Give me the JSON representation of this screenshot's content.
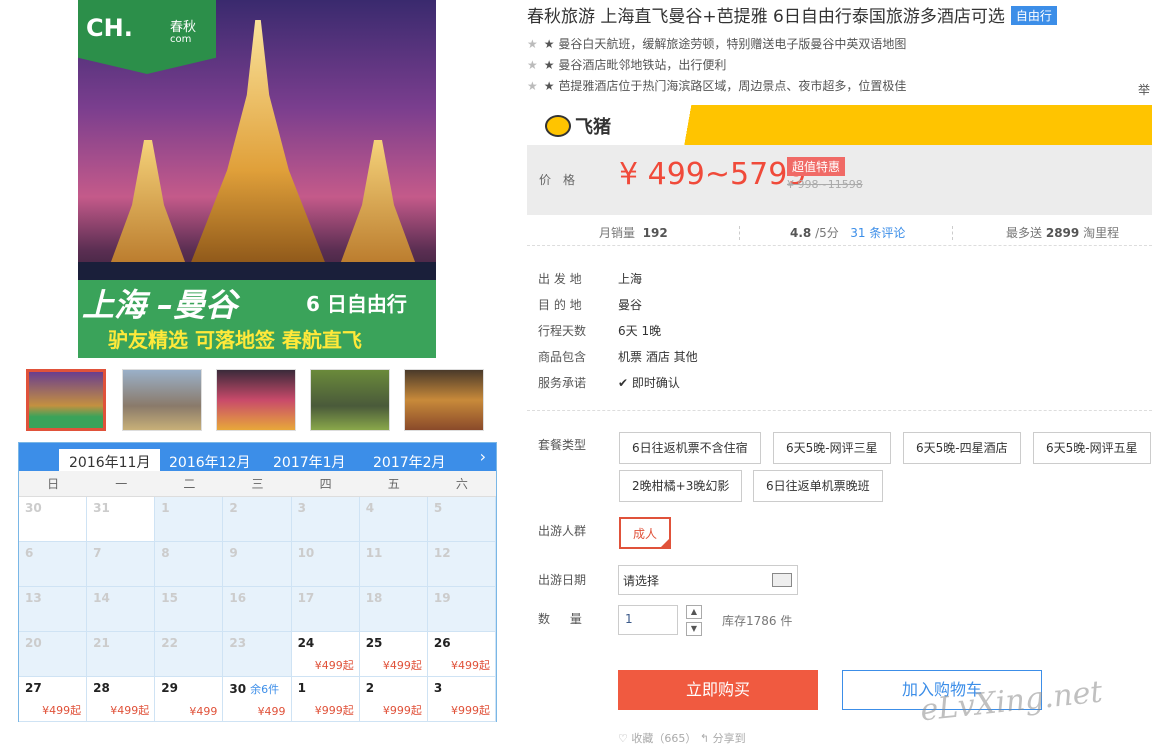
{
  "product": {
    "title": "春秋旅游 上海直飞曼谷+芭提雅 6日自由行泰国旅游多酒店可选",
    "badge": "自由行",
    "features": [
      "★ 曼谷白天航班，缓解旅途劳顿，特别赠送电子版曼谷中英双语地图",
      "★ 曼谷酒店毗邻地铁站，出行便利",
      "★ 芭提雅酒店位于热门海滨路区域，周边景点、夜市超多，位置极佳"
    ],
    "side_cut": "举"
  },
  "main_image": {
    "logo_ch": "CH.",
    "logo_cq": "春秋",
    "logo_com": "com",
    "banner_line1": "上海 –曼谷",
    "banner_line2": "6 日自由行",
    "banner_line3": "驴友精选 可落地签 春航直飞"
  },
  "platform": {
    "name": "飞猪",
    "accent": "#ffc400"
  },
  "price": {
    "label": "价格",
    "value": "¥ 499~5799",
    "hot": "超值特惠",
    "old": "¥ 998~11598",
    "color": "#f04a3a"
  },
  "stats": {
    "sales_label": "月销量",
    "sales": "192",
    "rating": "4.8",
    "rating_suffix": "/5分",
    "reviews": "31 条评论",
    "points_prefix": "最多送",
    "points": "2899",
    "points_suffix": "淘里程"
  },
  "info": {
    "depart_label": "出 发 地",
    "depart": "上海",
    "dest_label": "目 的 地",
    "dest": "曼谷",
    "days_label": "行程天数",
    "days": "6天 1晚",
    "includes_label": "商品包含",
    "includes": "机票  酒店  其他",
    "service_label": "服务承诺",
    "service": "即时确认"
  },
  "options": {
    "package_label": "套餐类型",
    "packages": [
      "6日往返机票不含住宿",
      "6天5晚-网评三星",
      "6天5晚-四星酒店",
      "6天5晚-网评五星",
      "2晚柑橘+3晚幻影",
      "6日往返单机票晚班"
    ],
    "crowd_label": "出游人群",
    "crowd": "成人",
    "date_label": "出游日期",
    "date_placeholder": "请选择",
    "qty_label": "数 量",
    "qty": "1",
    "stock": "库存1786 件"
  },
  "actions": {
    "buy": "立即购买",
    "cart": "加入购物车"
  },
  "watermark": "eLvXing.net",
  "bottom_cut": "♡ 收藏（665）        ↰ 分享到",
  "calendar": {
    "tabs": [
      "2016年11月",
      "2016年12月",
      "2017年1月",
      "2017年2月"
    ],
    "weekdays": [
      "日",
      "一",
      "二",
      "三",
      "四",
      "五",
      "六"
    ],
    "days": [
      {
        "d": "30",
        "p": "",
        "avail": false,
        "white": true
      },
      {
        "d": "31",
        "p": "",
        "avail": false,
        "white": true
      },
      {
        "d": "1",
        "p": "",
        "avail": false
      },
      {
        "d": "2",
        "p": "",
        "avail": false
      },
      {
        "d": "3",
        "p": "",
        "avail": false
      },
      {
        "d": "4",
        "p": "",
        "avail": false
      },
      {
        "d": "5",
        "p": "",
        "avail": false
      },
      {
        "d": "6",
        "p": "",
        "avail": false
      },
      {
        "d": "7",
        "p": "",
        "avail": false
      },
      {
        "d": "8",
        "p": "",
        "avail": false
      },
      {
        "d": "9",
        "p": "",
        "avail": false
      },
      {
        "d": "10",
        "p": "",
        "avail": false
      },
      {
        "d": "11",
        "p": "",
        "avail": false
      },
      {
        "d": "12",
        "p": "",
        "avail": false
      },
      {
        "d": "13",
        "p": "",
        "avail": false
      },
      {
        "d": "14",
        "p": "",
        "avail": false
      },
      {
        "d": "15",
        "p": "",
        "avail": false
      },
      {
        "d": "16",
        "p": "",
        "avail": false
      },
      {
        "d": "17",
        "p": "",
        "avail": false
      },
      {
        "d": "18",
        "p": "",
        "avail": false
      },
      {
        "d": "19",
        "p": "",
        "avail": false
      },
      {
        "d": "20",
        "p": "",
        "avail": false
      },
      {
        "d": "21",
        "p": "",
        "avail": false
      },
      {
        "d": "22",
        "p": "",
        "avail": false
      },
      {
        "d": "23",
        "p": "",
        "avail": false
      },
      {
        "d": "24",
        "p": "¥499起",
        "avail": true
      },
      {
        "d": "25",
        "p": "¥499起",
        "avail": true
      },
      {
        "d": "26",
        "p": "¥499起",
        "avail": true
      },
      {
        "d": "27",
        "p": "¥499起",
        "avail": true
      },
      {
        "d": "28",
        "p": "¥499起",
        "avail": true
      },
      {
        "d": "29",
        "p": "¥499",
        "avail": true
      },
      {
        "d": "30",
        "p": "¥499",
        "avail": true,
        "rem": "余6件"
      },
      {
        "d": "1",
        "p": "¥999起",
        "avail": true
      },
      {
        "d": "2",
        "p": "¥999起",
        "avail": true
      },
      {
        "d": "3",
        "p": "¥999起",
        "avail": true
      }
    ]
  }
}
